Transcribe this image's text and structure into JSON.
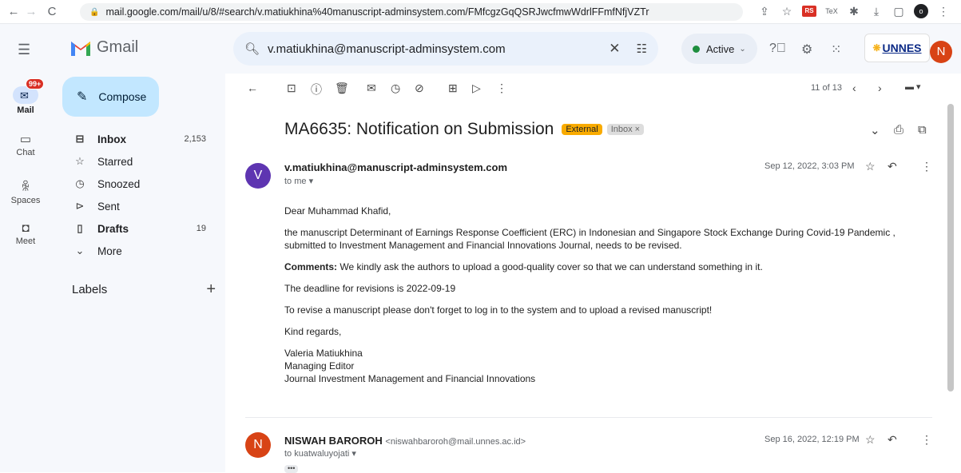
{
  "browser": {
    "url": "mail.google.com/mail/u/8/#search/v.matiukhina%40manuscript-adminsystem.com/FMfcgzGqQSRJwcfmwWdrlFFmfNfjVZTr",
    "ext_badge": "RS",
    "profile_initial": "o"
  },
  "header": {
    "app_name": "Gmail",
    "search_value": "v.matiukhina@manuscript-adminsystem.com",
    "status": "Active",
    "org_logo": "UNNES",
    "avatar_initial": "N"
  },
  "rail": {
    "mail_label": "Mail",
    "mail_badge": "99+",
    "chat_label": "Chat",
    "spaces_label": "Spaces",
    "meet_label": "Meet"
  },
  "sidebar": {
    "compose": "Compose",
    "items": [
      {
        "label": "Inbox",
        "count": "2,153",
        "icon": "inbox-icon"
      },
      {
        "label": "Starred",
        "count": "",
        "icon": "star-icon"
      },
      {
        "label": "Snoozed",
        "count": "",
        "icon": "clock-icon"
      },
      {
        "label": "Sent",
        "count": "",
        "icon": "send-icon"
      },
      {
        "label": "Drafts",
        "count": "19",
        "icon": "draft-icon"
      },
      {
        "label": "More",
        "count": "",
        "icon": "chevron-down-icon"
      }
    ],
    "labels_header": "Labels"
  },
  "toolbar": {
    "pager": "11 of 13"
  },
  "email": {
    "subject": "MA6635: Notification on Submission",
    "tag_external": "External",
    "tag_inbox": "Inbox",
    "message1": {
      "avatar": "V",
      "sender": "v.matiukhina@manuscript-adminsystem.com",
      "to": "to me",
      "date": "Sep 12, 2022, 3:03 PM",
      "greeting": "Dear Muhammad Khafid,",
      "para1": "the manuscript Determinant of Earnings Response Coefficient (ERC) in Indonesian and Singapore Stock Exchange During Covid-19 Pandemic , submitted to Investment Management and Financial Innovations Journal, needs to be revised.",
      "comments_label": "Comments:",
      "comments_text": " We kindly ask the authors to upload a good-quality cover so that we can understand something in it.",
      "deadline": "The deadline for revisions is 2022-09-19",
      "instructions": "To revise a manuscript please don't forget to log in to the system and to upload a revised manuscript!",
      "closing": "Kind regards,",
      "sig_name": "Valeria Matiukhina",
      "sig_title": "Managing Editor",
      "sig_org": "Journal Investment Management and Financial Innovations"
    },
    "message2": {
      "avatar": "N",
      "sender": "NISWAH BAROROH",
      "sender_email": "<niswahbaroroh@mail.unnes.ac.id>",
      "to": "to kuatwaluyojati",
      "date": "Sep 16, 2022, 12:19 PM",
      "dots": "•••"
    }
  },
  "colors": {
    "accent": "#c2e7ff",
    "avatar_v": "#5e35b1",
    "avatar_n": "#d84315",
    "external_tag": "#f9ab00"
  }
}
